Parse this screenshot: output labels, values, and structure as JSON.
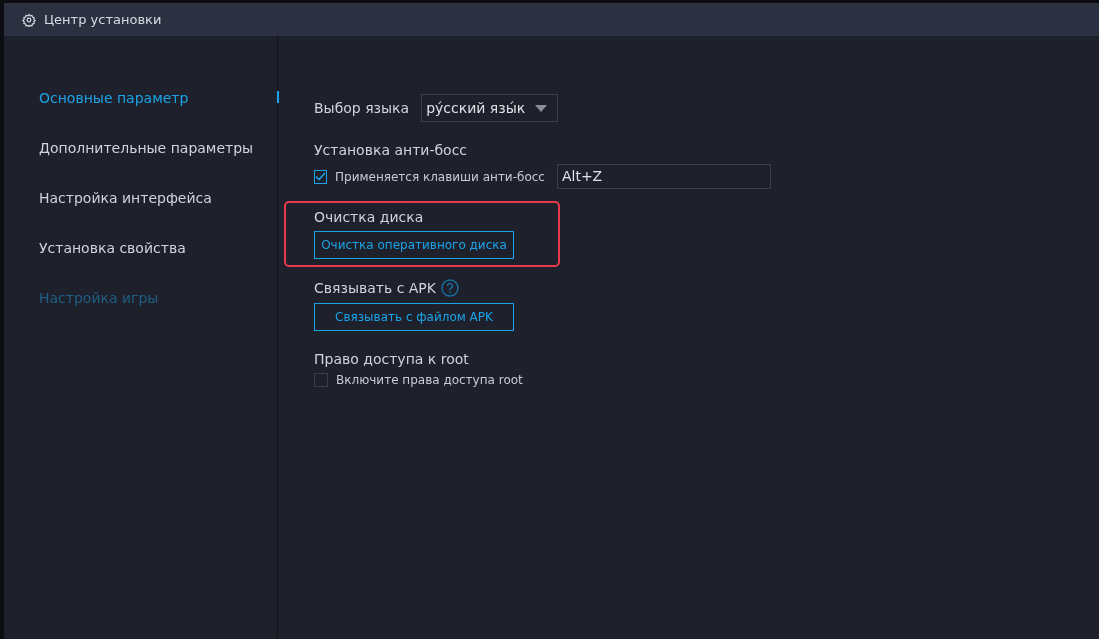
{
  "window": {
    "title": "Центр установки"
  },
  "sidebar": {
    "items": [
      {
        "label": "Основные параметр",
        "selected": true,
        "disabled": false
      },
      {
        "label": "Дополнительные параметры",
        "selected": false,
        "disabled": false
      },
      {
        "label": "Настройка интерфейса",
        "selected": false,
        "disabled": false
      },
      {
        "label": "Установка свойства",
        "selected": false,
        "disabled": false
      },
      {
        "label": "Настройка игры",
        "selected": false,
        "disabled": true
      }
    ]
  },
  "sections": [
    {
      "kind": "select",
      "label": "Выбор языка",
      "value": "ру́сский язы́к",
      "highlighted": false
    },
    {
      "kind": "checkbox-input",
      "title": "Установка анти-босс",
      "checkbox_label": "Применяется клавиши анти-босс",
      "checked": true,
      "value": "Alt+Z",
      "highlighted": false
    },
    {
      "kind": "button",
      "title": "Очистка диска",
      "button": "Очистка оперативного диска",
      "help": false,
      "highlighted": true
    },
    {
      "kind": "button",
      "title": "Связывать с APK",
      "button": "Связывать с файлом APK",
      "help": true,
      "highlighted": false
    },
    {
      "kind": "checkbox",
      "title": "Право доступа к root",
      "checkbox_label": "Включите права доступа root",
      "checked": false,
      "highlighted": false
    }
  ]
}
